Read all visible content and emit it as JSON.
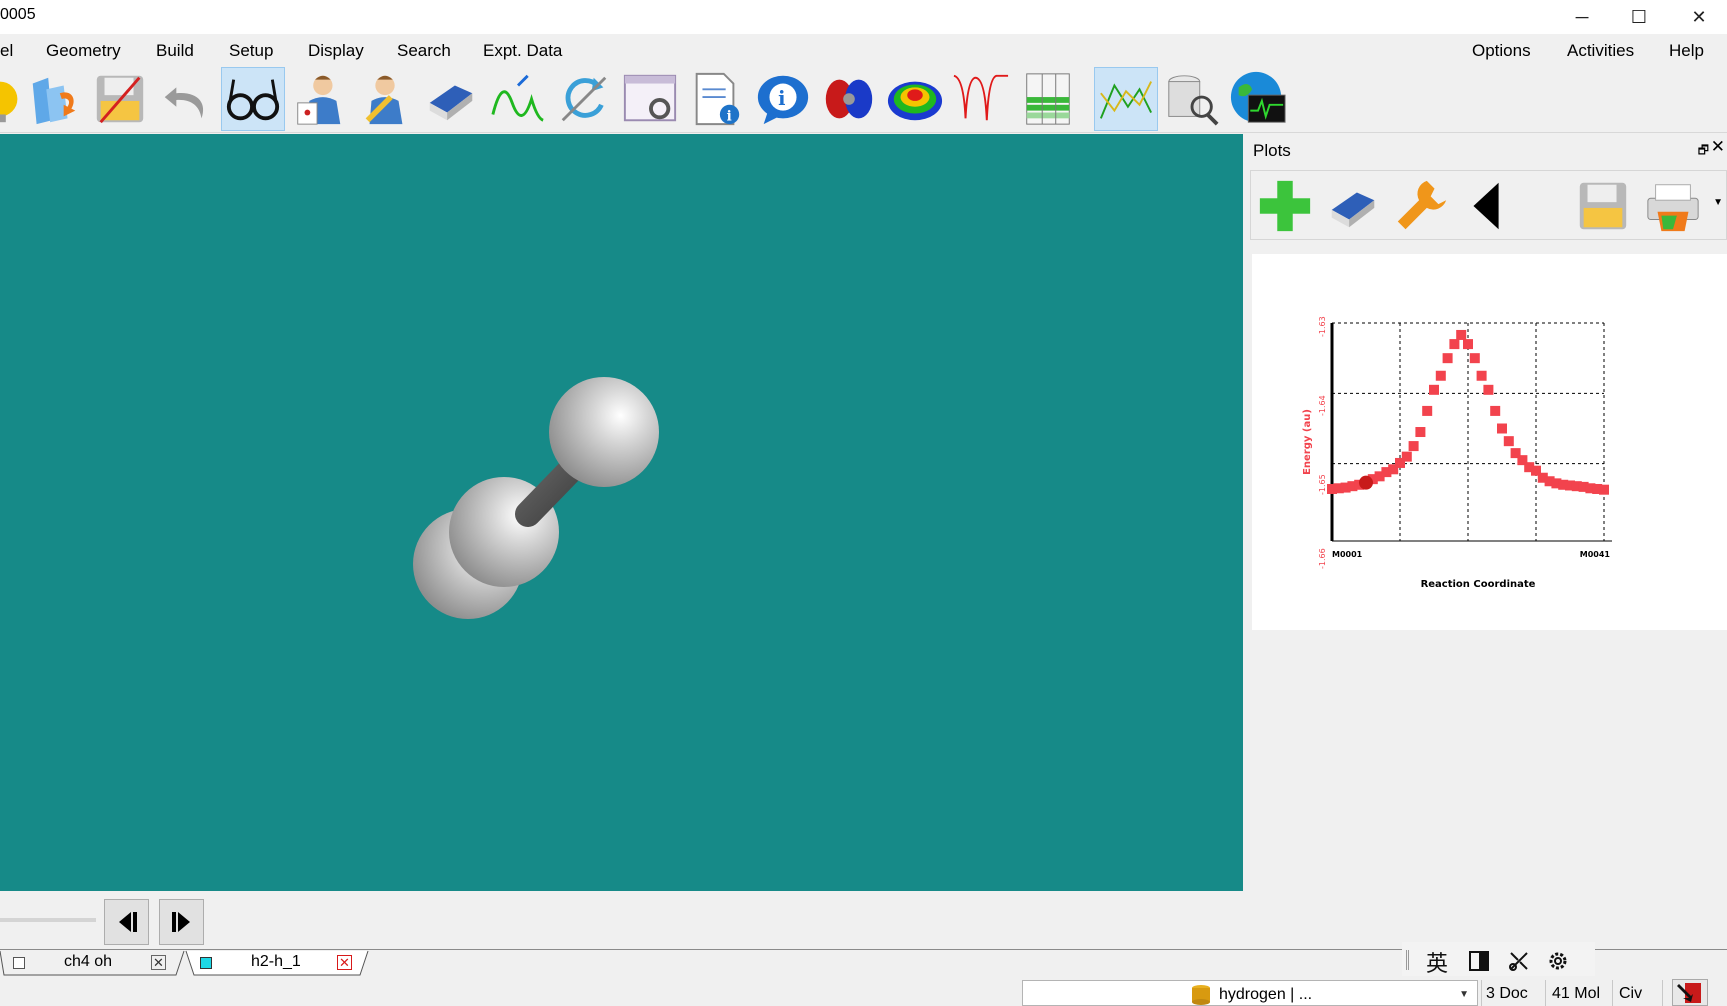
{
  "window": {
    "title": "0005",
    "minimize_icon": "─",
    "maximize_icon": "☐",
    "close_icon": "✕"
  },
  "menu": {
    "left": [
      "el",
      "Geometry",
      "Build",
      "Setup",
      "Display",
      "Search",
      "Expt. Data"
    ],
    "right": [
      "Options",
      "Activities",
      "Help"
    ]
  },
  "toolbar": {
    "icons": [
      "bulb-icon",
      "open-folder-icon",
      "save-disk-icon",
      "undo-icon",
      "glasses-icon",
      "builder-person-icon",
      "editor-person-icon",
      "eraser-icon",
      "wave-icon",
      "refresh-icon",
      "window-settings-icon",
      "doc-info-icon",
      "info-bubble-icon",
      "orbital-icon",
      "surface-icon",
      "spectrum-icon",
      "table-icon",
      "plot-icon",
      "database-search-icon",
      "globe-monitor-icon"
    ],
    "active": [
      "glasses-icon",
      "plot-icon"
    ]
  },
  "viewport": {
    "background": "#168a88",
    "molecule": "H-H + H"
  },
  "plots_panel": {
    "title": "Plots",
    "float_icon": "🗗",
    "close_icon": "✕",
    "tools": [
      "add-plot-icon",
      "eraser-icon",
      "wrench-icon",
      "back-arrow-icon",
      "save-disk-icon",
      "print-icon"
    ]
  },
  "chart_data": {
    "type": "scatter",
    "title": "",
    "xlabel": "Reaction Coordinate",
    "ylabel": "Energy (au)",
    "x_tick_labels": [
      "M0001",
      "M0041"
    ],
    "y_tick_labels": [
      "-1.63",
      "-1.64",
      "-1.65",
      "-1.66"
    ],
    "ylim": [
      -1.66,
      -1.63
    ],
    "xlim": [
      1,
      41
    ],
    "grid": true,
    "series": [
      {
        "color": "#f2434d",
        "x": [
          1,
          2,
          3,
          4,
          5,
          6,
          7,
          8,
          9,
          10,
          11,
          12,
          13,
          14,
          15,
          16,
          17,
          18,
          19,
          20,
          21,
          22,
          23,
          24,
          25,
          26,
          27,
          28,
          29,
          30,
          31,
          32,
          33,
          34,
          35,
          36,
          37,
          38,
          39,
          40,
          41
        ],
        "y": [
          -1.6536,
          -1.6535,
          -1.6534,
          -1.6532,
          -1.653,
          -1.6527,
          -1.6522,
          -1.6518,
          -1.6512,
          -1.6508,
          -1.6499,
          -1.649,
          -1.6475,
          -1.6455,
          -1.6425,
          -1.6395,
          -1.6375,
          -1.635,
          -1.633,
          -1.6317,
          -1.633,
          -1.635,
          -1.6375,
          -1.6395,
          -1.6425,
          -1.645,
          -1.6468,
          -1.6485,
          -1.6495,
          -1.6505,
          -1.651,
          -1.652,
          -1.6525,
          -1.6528,
          -1.653,
          -1.6531,
          -1.6532,
          -1.6533,
          -1.6535,
          -1.6536,
          -1.6537
        ]
      }
    ],
    "marker_current_index": 5
  },
  "playback": {
    "prev_icon": "step-back-icon",
    "next_icon": "step-forward-icon"
  },
  "tabs": [
    {
      "label": "ch4 oh",
      "active": false
    },
    {
      "label": "h2-h_1",
      "active": true
    }
  ],
  "tab_close_icon": "✕",
  "ime": {
    "lang": "英",
    "icons": [
      "half-width-icon",
      "tools-icon",
      "gear-icon"
    ]
  },
  "status": {
    "database": "hydrogen | ...",
    "docs": "3 Doc",
    "mols": "41 Mol",
    "civ": "Civ"
  }
}
